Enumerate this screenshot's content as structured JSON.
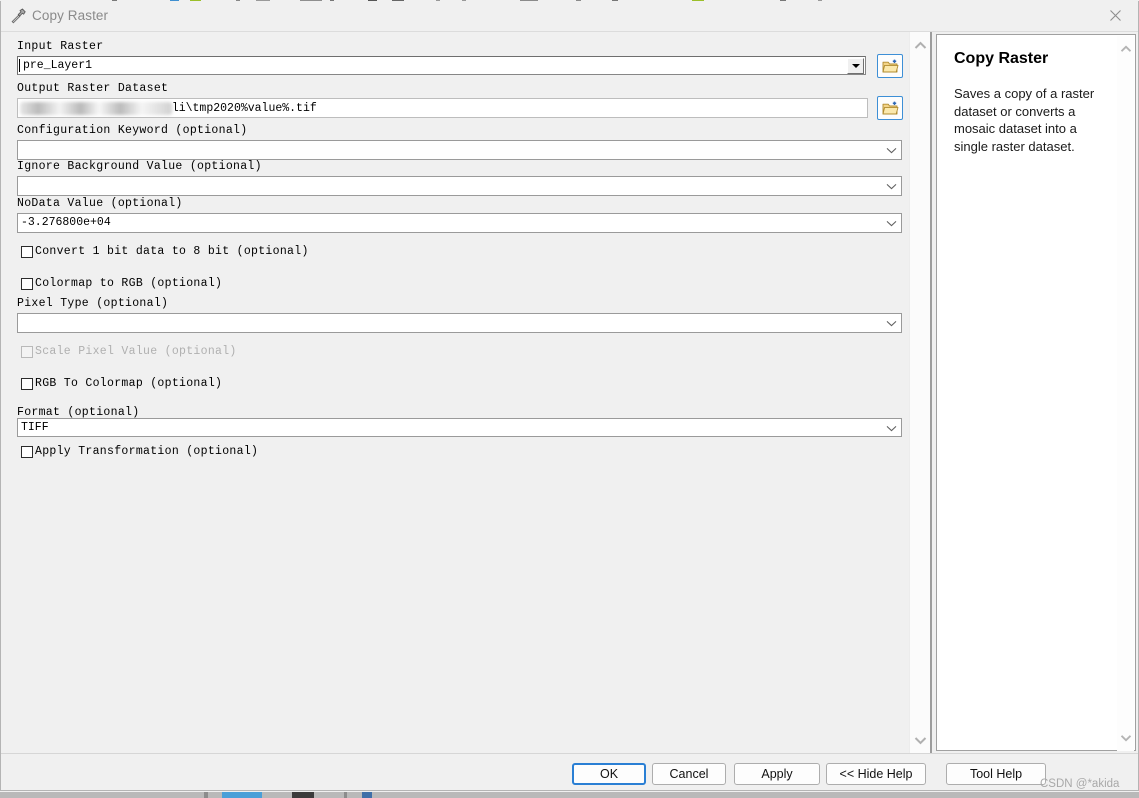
{
  "window": {
    "title": "Copy Raster",
    "title_icon": "hammer-tool-icon",
    "close_icon": "close-icon"
  },
  "form": {
    "fields": [
      {
        "label": "Input Raster",
        "value": "pre_Layer1",
        "control": "combobox-classic",
        "browse": true
      },
      {
        "label": "Output Raster Dataset",
        "value_redacted_prefix": "D:\\Folder\\path\\2020\\ab",
        "value_visible_suffix": "li\\tmp2020%value%.tif",
        "control": "textbox",
        "browse": true
      },
      {
        "label": "Configuration Keyword (optional)",
        "value": "",
        "control": "combobox"
      },
      {
        "label": "Ignore Background Value (optional)",
        "value": "",
        "control": "combobox"
      },
      {
        "label": "NoData Value (optional)",
        "value": "-3.276800e+04",
        "control": "combobox"
      },
      {
        "label": "Pixel Type (optional)",
        "value": "",
        "control": "combobox"
      },
      {
        "label": "Format (optional)",
        "value": "TIFF",
        "control": "combobox"
      }
    ],
    "checkboxes": [
      {
        "label": "Convert 1 bit data to 8 bit (optional)",
        "checked": false,
        "enabled": true
      },
      {
        "label": "Colormap to RGB (optional)",
        "checked": false,
        "enabled": true
      },
      {
        "label": "Scale Pixel Value (optional)",
        "checked": false,
        "enabled": false
      },
      {
        "label": "RGB To Colormap (optional)",
        "checked": false,
        "enabled": true
      },
      {
        "label": "Apply Transformation (optional)",
        "checked": false,
        "enabled": true
      }
    ],
    "browse_icon": "folder-browse-icon"
  },
  "help": {
    "title": "Copy Raster",
    "description": "Saves a copy of a raster dataset or converts a mosaic dataset into a single raster dataset."
  },
  "footer": {
    "buttons": [
      {
        "label": "OK",
        "primary": true
      },
      {
        "label": "Cancel",
        "primary": false
      },
      {
        "label": "Apply",
        "primary": false
      },
      {
        "label": "<< Hide Help",
        "primary": false
      },
      {
        "label": "Tool Help",
        "primary": false
      }
    ]
  },
  "watermark": "CSDN @*akida",
  "scrollbars": {
    "up_icon": "chevron-up-icon",
    "down_icon": "chevron-down-icon"
  },
  "colors": {
    "dialog_bg": "#f0f0f0",
    "panel_bg": "#ffffff",
    "accent_blue": "#2a7fd4",
    "browse_border": "#3d8fd6",
    "title_text": "#8a8a8a",
    "disabled_text": "#b0b0b0"
  }
}
